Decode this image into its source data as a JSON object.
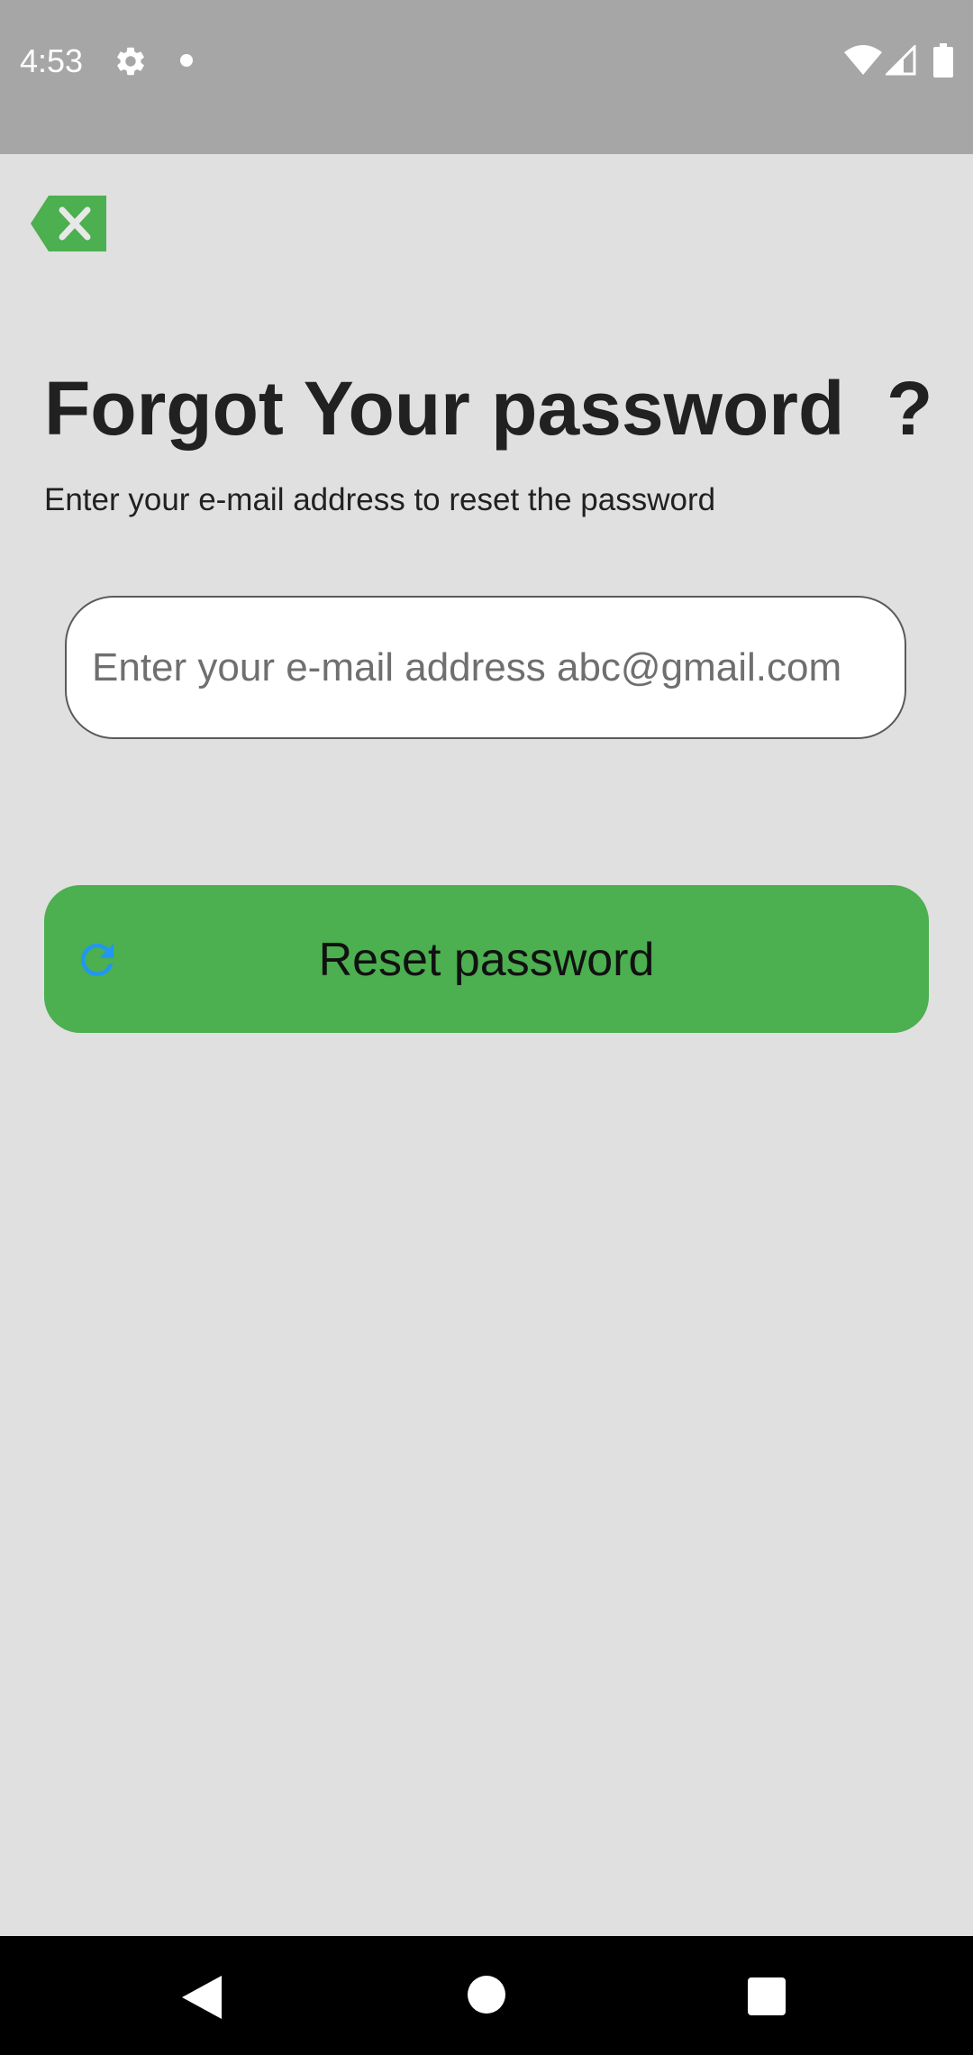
{
  "status_bar": {
    "time": "4:53",
    "icons": [
      "gear-icon",
      "notification-dot-icon",
      "wifi-icon",
      "signal-icon",
      "battery-icon"
    ]
  },
  "header": {
    "close_icon": "close-x-icon"
  },
  "main": {
    "title": "Forgot Your password  ?",
    "subtitle": "Enter your e-mail address to reset the password",
    "email_input": {
      "placeholder": "Enter your e-mail address abc@gmail.com",
      "value": ""
    },
    "reset_button": {
      "label": "Reset password",
      "icon": "refresh-icon"
    }
  },
  "nav_bar": {
    "icons": [
      "back-triangle-icon",
      "home-circle-icon",
      "recents-square-icon"
    ]
  },
  "colors": {
    "accent_green": "#4caf50",
    "refresh_icon_blue": "#2196f3",
    "background": "#e0e0e0",
    "status_bar": "#a6a6a6",
    "text": "#212121"
  }
}
